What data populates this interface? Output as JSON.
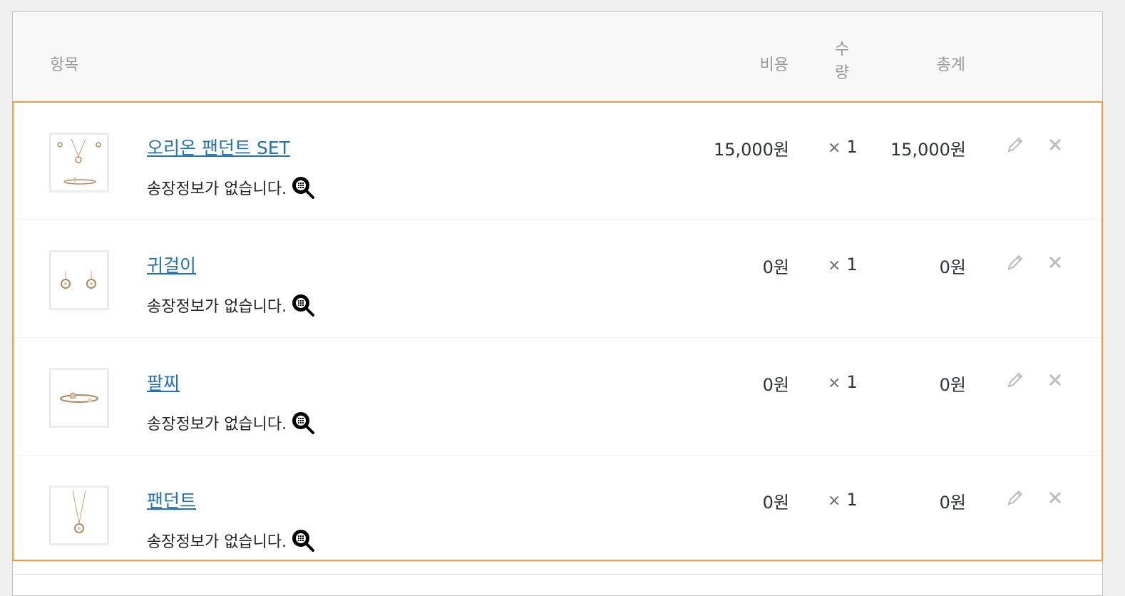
{
  "header": {
    "item": "항목",
    "cost": "비용",
    "qty_line1": "수",
    "qty_line2": "량",
    "total": "총계"
  },
  "items": [
    {
      "name": "오리온 팬던트 SET",
      "ship_note": "송장정보가 없습니다.",
      "cost": "15,000원",
      "qty_mark": "×",
      "qty": "1",
      "total": "15,000원",
      "thumb": "necklace-set"
    },
    {
      "name": "귀걸이",
      "ship_note": "송장정보가 없습니다.",
      "cost": "0원",
      "qty_mark": "×",
      "qty": "1",
      "total": "0원",
      "thumb": "earrings"
    },
    {
      "name": "팔찌",
      "ship_note": "송장정보가 없습니다.",
      "cost": "0원",
      "qty_mark": "×",
      "qty": "1",
      "total": "0원",
      "thumb": "bracelet"
    },
    {
      "name": "팬던트",
      "ship_note": "송장정보가 없습니다.",
      "cost": "0원",
      "qty_mark": "×",
      "qty": "1",
      "total": "0원",
      "thumb": "pendant"
    }
  ],
  "icons": {
    "edit": "pencil-icon",
    "delete": "close-icon",
    "tracking": "magnifier-icon"
  },
  "colors": {
    "accent_border": "#f29b38",
    "link": "#2271b1"
  }
}
